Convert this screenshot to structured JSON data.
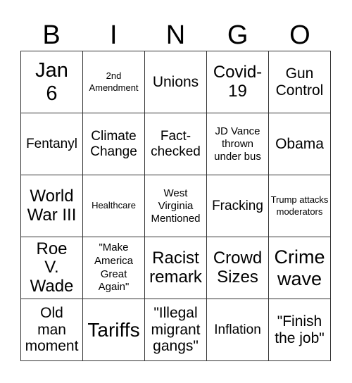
{
  "header": {
    "letters": [
      "B",
      "I",
      "N",
      "G",
      "O"
    ]
  },
  "grid": {
    "rows": [
      [
        "Jan 6",
        "2nd Amendment",
        "Unions",
        "Covid-19",
        "Gun Control"
      ],
      [
        "Fentanyl",
        "Climate Change",
        "Fact-checked",
        "JD Vance thrown under bus",
        "Obama"
      ],
      [
        "World War III",
        "Healthcare",
        "West Virginia Mentioned",
        "Fracking",
        "Trump attacks moderators"
      ],
      [
        "Roe V. Wade",
        "\"Make America Great Again\"",
        "Racist remark",
        "Crowd Sizes",
        "Crime wave"
      ],
      [
        "Old man moment",
        "Tariffs",
        "\"Illegal migrant gangs\"",
        "Inflation",
        "\"Finish the job\""
      ]
    ]
  }
}
